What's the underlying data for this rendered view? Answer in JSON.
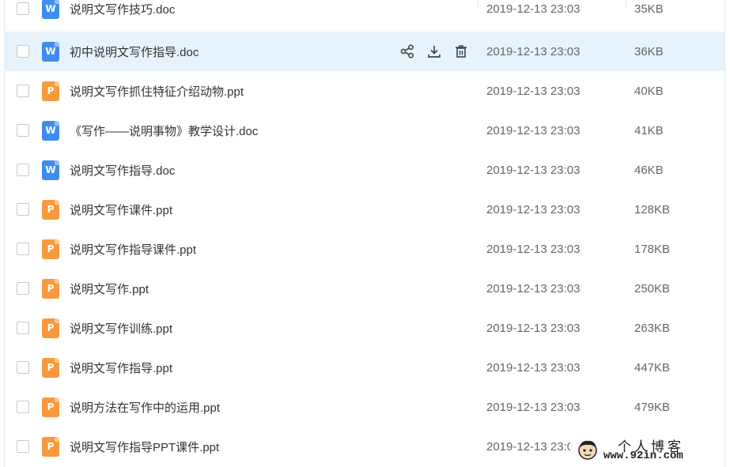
{
  "files": [
    {
      "name": "说明文写作技巧.doc",
      "type": "doc",
      "icon_letter": "W",
      "date": "2019-12-13 23:03",
      "size": "35KB"
    },
    {
      "name": "初中说明文写作指导.doc",
      "type": "doc",
      "icon_letter": "W",
      "date": "2019-12-13 23:03",
      "size": "36KB"
    },
    {
      "name": "说明文写作抓住特征介绍动物.ppt",
      "type": "ppt",
      "icon_letter": "P",
      "date": "2019-12-13 23:03",
      "size": "40KB"
    },
    {
      "name": "《写作——说明事物》教学设计.doc",
      "type": "doc",
      "icon_letter": "W",
      "date": "2019-12-13 23:03",
      "size": "41KB"
    },
    {
      "name": "说明文写作指导.doc",
      "type": "doc",
      "icon_letter": "W",
      "date": "2019-12-13 23:03",
      "size": "46KB"
    },
    {
      "name": "说明文写作课件.ppt",
      "type": "ppt",
      "icon_letter": "P",
      "date": "2019-12-13 23:03",
      "size": "128KB"
    },
    {
      "name": "说明文写作指导课件.ppt",
      "type": "ppt",
      "icon_letter": "P",
      "date": "2019-12-13 23:03",
      "size": "178KB"
    },
    {
      "name": "说明文写作.ppt",
      "type": "ppt",
      "icon_letter": "P",
      "date": "2019-12-13 23:03",
      "size": "250KB"
    },
    {
      "name": "说明文写作训练.ppt",
      "type": "ppt",
      "icon_letter": "P",
      "date": "2019-12-13 23:03",
      "size": "263KB"
    },
    {
      "name": "说明文写作指导.ppt",
      "type": "ppt",
      "icon_letter": "P",
      "date": "2019-12-13 23:03",
      "size": "447KB"
    },
    {
      "name": "说明方法在写作中的运用.ppt",
      "type": "ppt",
      "icon_letter": "P",
      "date": "2019-12-13 23:03",
      "size": "479KB"
    },
    {
      "name": "说明文写作指导PPT课件.ppt",
      "type": "ppt",
      "icon_letter": "P",
      "date": "2019-12-13 23:03",
      "size": ""
    }
  ],
  "hover_row": 1,
  "hover_actions": [
    {
      "name": "share-icon"
    },
    {
      "name": "download-icon"
    },
    {
      "name": "delete-icon"
    }
  ],
  "watermark": {
    "title": "个人博客",
    "url": "www.92in.com"
  },
  "colors": {
    "doc_icon": "#3f8cf0",
    "ppt_icon": "#f79a3e",
    "hover_bg": "#e6f3fc"
  }
}
